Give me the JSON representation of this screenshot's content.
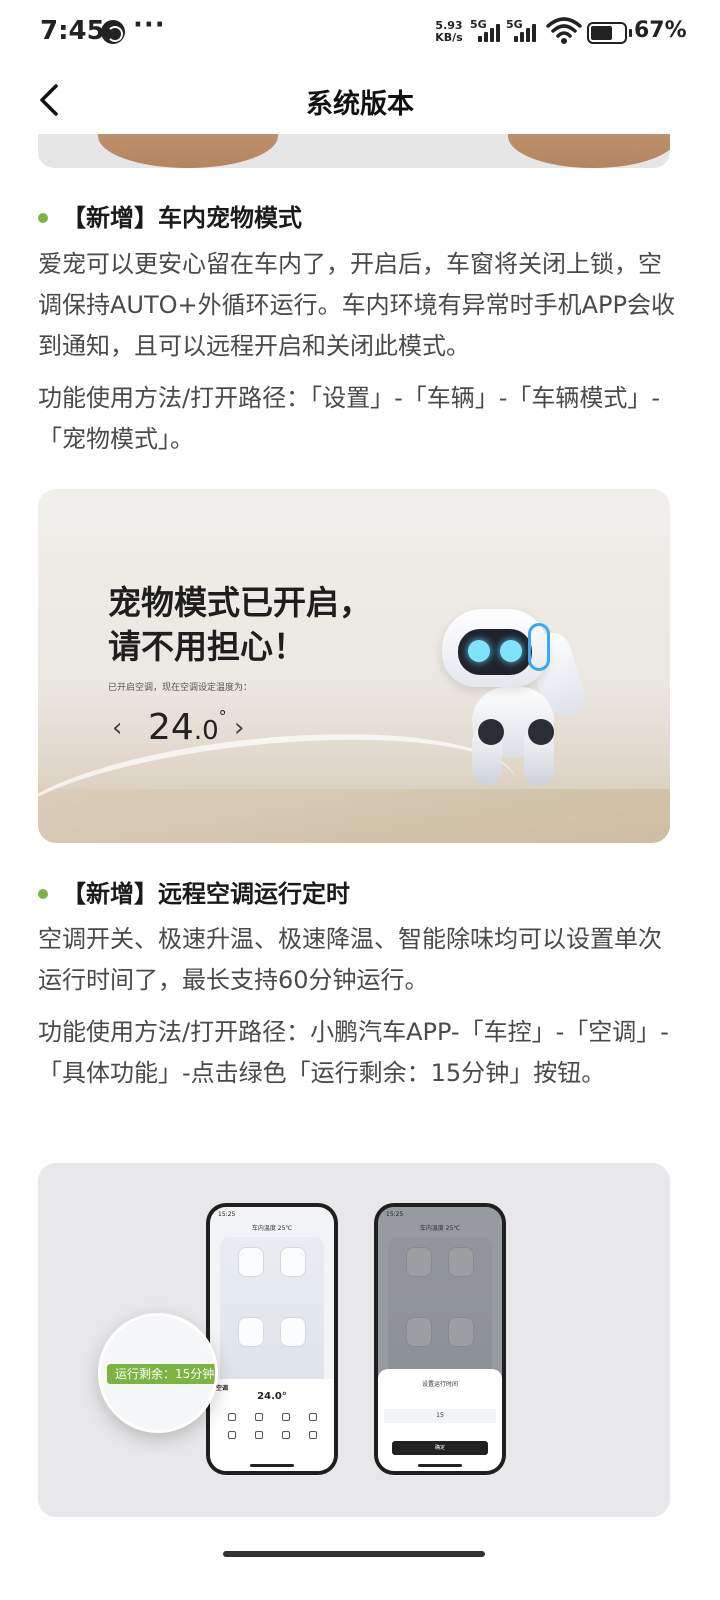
{
  "status_bar": {
    "time": "7:45",
    "more": "···",
    "net_speed": "5.93\nKB/s",
    "sim1_label": "5G",
    "sim2_label": "5G",
    "battery_text": "67%",
    "battery_level": 0.67
  },
  "nav": {
    "title": "系统版本",
    "back_icon": "chevron-left-icon"
  },
  "sections": [
    {
      "title": "【新增】车内宠物模式",
      "body": "爱宠可以更安心留在车内了，开启后，车窗将关闭上锁，空调保持AUTO+外循环运行。车内环境有异常时手机APP会收到通知，且可以远程开启和关闭此模式。",
      "usage": "功能使用方法/打开路径：「设置」-「车辆」-「车辆模式」-「宠物模式」。"
    },
    {
      "title": "【新增】远程空调运行定时",
      "body": "空调开关、极速升温、极速降温、智能除味均可以设置单次运行时间了，最长支持60分钟运行。",
      "usage": "功能使用方法/打开路径：小鹏汽车APP-「车控」-「空调」-「具体功能」-点击绿色「运行剩余：15分钟」按钮。"
    }
  ],
  "pet_card": {
    "title_line1": "宠物模式已开启，",
    "title_line2": "请不用担心！",
    "subtitle": "已开启空调，现在空调设定温度为：",
    "temp_int": "24",
    "temp_dec": ".0",
    "temp_unit": "°",
    "prev": "‹",
    "next": "›"
  },
  "phones_card": {
    "phone1": {
      "status": "15:25",
      "header": "车内温度 25℃",
      "ac_label": "空调",
      "temp": "24.0°"
    },
    "phone2": {
      "status": "15:25",
      "header": "车内温度 25℃",
      "sheet_title": "设置运行时间",
      "sheet_value": "15",
      "sheet_button": "确定"
    },
    "run_pill": "运行剩余：15分钟 ›"
  },
  "colors": {
    "accent_green": "#7cb342"
  }
}
